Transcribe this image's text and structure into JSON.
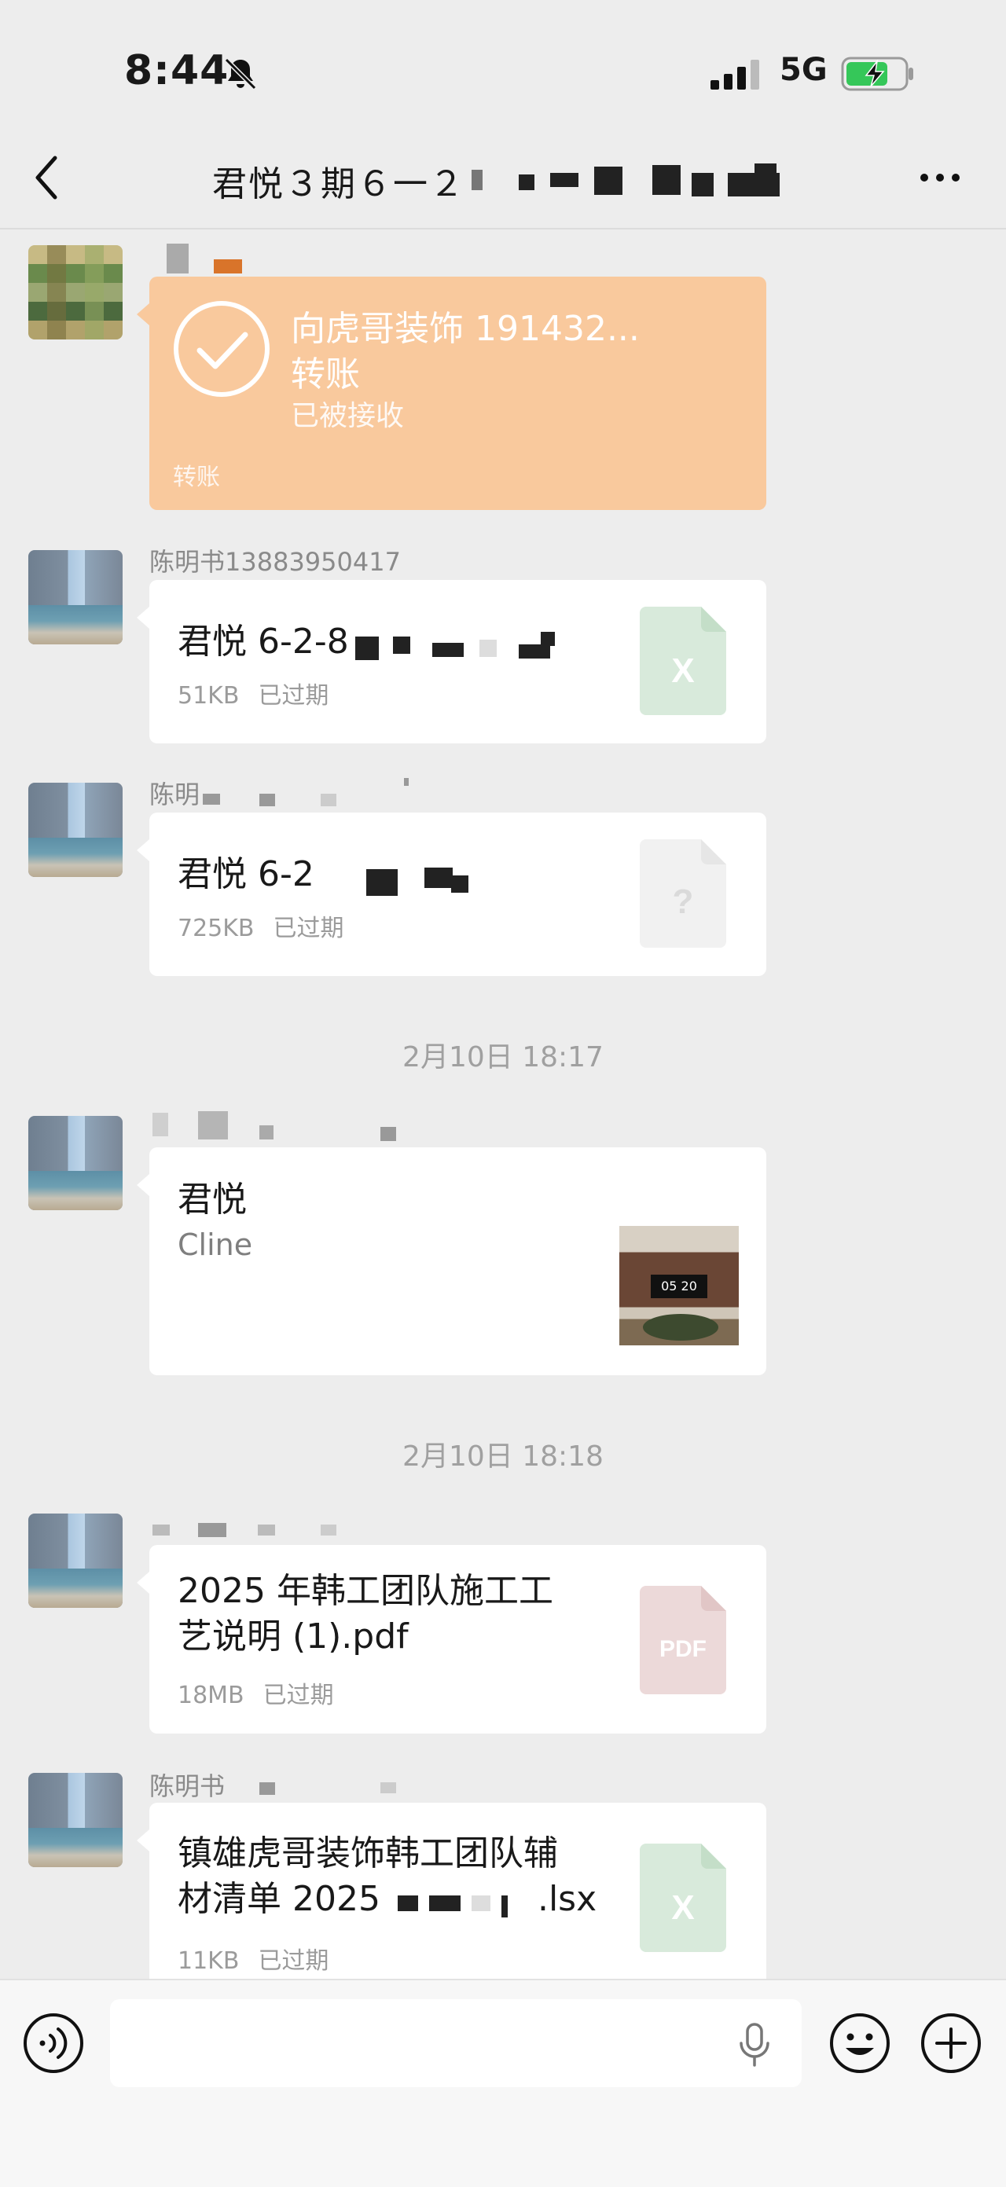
{
  "status_bar": {
    "time": "8:44",
    "network": "5G",
    "icons": [
      "bell-muted-icon",
      "signal-icon",
      "battery-charging-icon"
    ]
  },
  "nav": {
    "title": "君悦３期６一２",
    "back_icon": "chevron-left-icon",
    "more_icon": "more-dots-icon"
  },
  "messages": [
    {
      "type": "transfer",
      "title": "向虎哥装饰 191432...",
      "subtitle": "转账",
      "status": "已被接收",
      "footer": "转账"
    },
    {
      "type": "file",
      "sender": "陈明书13883950417",
      "name": "君悦 6-2-8",
      "size": "51KB",
      "state": "已过期",
      "icon": "excel-icon",
      "icon_label": "X"
    },
    {
      "type": "file",
      "sender": "陈明",
      "name": "君悦 6-2",
      "size": "725KB",
      "state": "已过期",
      "icon": "unknown-file-icon",
      "icon_label": "?"
    },
    {
      "type": "timestamp",
      "text": "2月10日 18:17"
    },
    {
      "type": "link",
      "title": "君悦",
      "subtitle": "Cline"
    },
    {
      "type": "timestamp",
      "text": "2月10日 18:18"
    },
    {
      "type": "file",
      "name_line1": "2025 年韩工团队施工工",
      "name_line2": "艺说明 (1).pdf",
      "size": "18MB",
      "state": "已过期",
      "icon": "pdf-icon",
      "icon_label": "PDF"
    },
    {
      "type": "file",
      "sender": "陈明书",
      "name_line1": "镇雄虎哥装饰韩工团队辅",
      "name_line2_a": "材清单 2025",
      "name_line2_b": ".lsx",
      "size": "11KB",
      "state": "已过期",
      "icon": "excel-icon",
      "icon_label": "X"
    }
  ],
  "link_thumb_text": "05 20",
  "colors": {
    "background": "#ededed",
    "transfer": "#f9c99d",
    "excel_icon": "#d8eadb",
    "pdf_icon": "#ecd9d9",
    "unknown_icon": "#f1f1f1"
  }
}
